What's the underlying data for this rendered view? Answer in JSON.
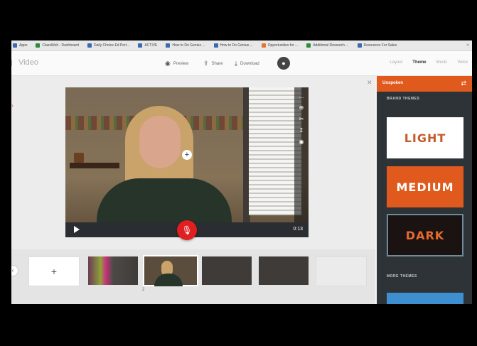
{
  "bookmarks": {
    "items": [
      {
        "label": "Apps",
        "icon": "apps-icon"
      },
      {
        "label": "ClassWeb - Dashboard",
        "icon": "bookmark-icon"
      },
      {
        "label": "Daily Choice Ed Port...",
        "icon": "bookmark-icon"
      },
      {
        "label": "ACTIVE",
        "icon": "bookmark-icon"
      },
      {
        "label": "How to Do Genius ...",
        "icon": "bookmark-icon"
      },
      {
        "label": "How to Do Genius ...",
        "icon": "bookmark-icon"
      },
      {
        "label": "Opportunities for ...",
        "icon": "bookmark-icon"
      },
      {
        "label": "Additional Research ...",
        "icon": "bookmark-icon"
      },
      {
        "label": "Resources For Sales",
        "icon": "bookmark-icon"
      }
    ]
  },
  "header": {
    "title": "Video",
    "preview_label": "Preview",
    "share_label": "Share",
    "download_label": "Download",
    "avatar_initial": "●",
    "tabs": [
      "Layout",
      "Theme",
      "Music",
      "Voice"
    ],
    "active_tab": "Theme"
  },
  "video": {
    "time": "0:13",
    "tools": [
      "...",
      "⊕",
      "✂",
      "↥",
      "◉"
    ]
  },
  "timeline": {
    "add_label": "+",
    "slide_number": "2"
  },
  "panel": {
    "title": "Unspoken",
    "brand_themes_label": "BRAND THEMES",
    "more_themes_label": "MORE THEMES",
    "themes": [
      "LIGHT",
      "MEDIUM",
      "DARK"
    ],
    "accent": "#e05a1e"
  }
}
